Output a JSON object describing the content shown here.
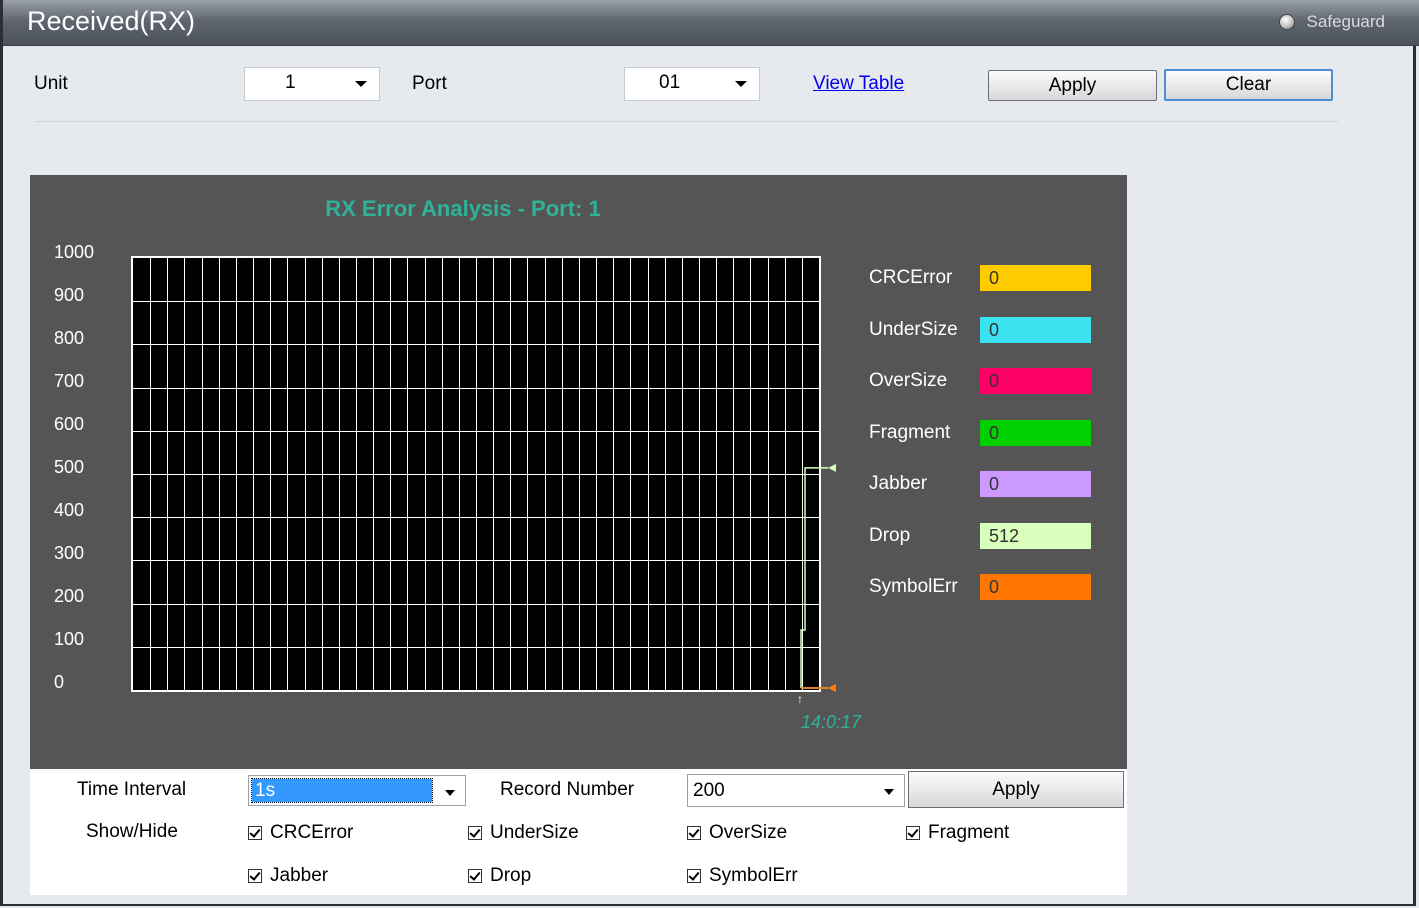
{
  "window": {
    "title": "Received(RX)",
    "safeguard_label": "Safeguard"
  },
  "top_bar": {
    "unit_label": "Unit",
    "unit_value": "1",
    "port_label": "Port",
    "port_value": "01",
    "view_table_link": "View Table",
    "apply_label": "Apply",
    "clear_label": "Clear"
  },
  "chart": {
    "title": "RX Error Analysis - Port: 1",
    "timestamp": "14:0:17",
    "legend": [
      {
        "name": "CRCError",
        "value": "0",
        "color": "#ffcc00"
      },
      {
        "name": "UnderSize",
        "value": "0",
        "color": "#3be3f0"
      },
      {
        "name": "OverSize",
        "value": "0",
        "color": "#ff0066"
      },
      {
        "name": "Fragment",
        "value": "0",
        "color": "#00d000"
      },
      {
        "name": "Jabber",
        "value": "0",
        "color": "#cc99ff"
      },
      {
        "name": "Drop",
        "value": "512",
        "color": "#d8ffbb"
      },
      {
        "name": "SymbolErr",
        "value": "0",
        "color": "#ff7700"
      }
    ]
  },
  "chart_data": {
    "type": "line",
    "title": "RX Error Analysis - Port: 1",
    "ylim": [
      0,
      1000
    ],
    "yticks": [
      1000,
      900,
      800,
      700,
      600,
      500,
      400,
      300,
      200,
      100,
      0
    ],
    "x": [
      "14:0:17"
    ],
    "series": [
      {
        "name": "CRCError",
        "values": [
          0
        ]
      },
      {
        "name": "UnderSize",
        "values": [
          0
        ]
      },
      {
        "name": "OverSize",
        "values": [
          0
        ]
      },
      {
        "name": "Fragment",
        "values": [
          0
        ]
      },
      {
        "name": "Jabber",
        "values": [
          0
        ]
      },
      {
        "name": "Drop",
        "values": [
          512
        ]
      },
      {
        "name": "SymbolErr",
        "values": [
          0
        ]
      }
    ]
  },
  "controls": {
    "time_interval_label": "Time Interval",
    "time_interval_value": "1s",
    "record_number_label": "Record Number",
    "record_number_value": "200",
    "apply_label": "Apply",
    "show_hide_label": "Show/Hide",
    "checkboxes": [
      {
        "label": "CRCError",
        "checked": true
      },
      {
        "label": "UnderSize",
        "checked": true
      },
      {
        "label": "OverSize",
        "checked": true
      },
      {
        "label": "Fragment",
        "checked": true
      },
      {
        "label": "Jabber",
        "checked": true
      },
      {
        "label": "Drop",
        "checked": true
      },
      {
        "label": "SymbolErr",
        "checked": true
      }
    ]
  }
}
